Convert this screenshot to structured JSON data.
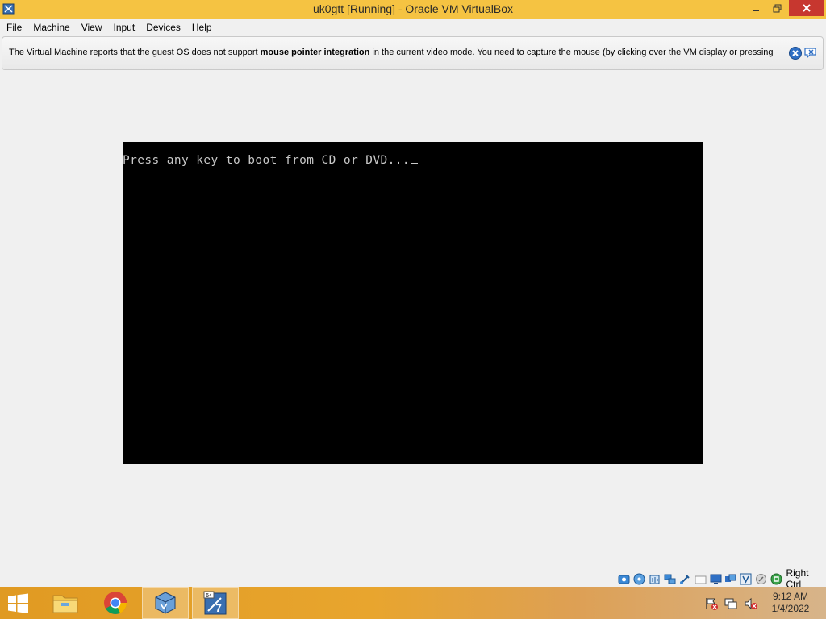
{
  "window": {
    "title": "uk0gtt [Running] - Oracle VM VirtualBox"
  },
  "menu": [
    "File",
    "Machine",
    "View",
    "Input",
    "Devices",
    "Help"
  ],
  "notice": {
    "text_before": "The Virtual Machine reports that the guest OS does not support ",
    "text_bold": "mouse pointer integration",
    "text_after": " in the current video mode. You need to capture the mouse (by clicking over the VM display or pressing"
  },
  "vm": {
    "console_text": "Press any key to boot from CD or DVD..."
  },
  "statusbar": {
    "icons": [
      "hard-disk-icon",
      "optical-disk-icon",
      "audio-icon",
      "network-icon",
      "usb-icon",
      "shared-folders-icon",
      "display-icon",
      "video-capture-icon",
      "cpu-virtualization-icon",
      "mouse-integration-icon",
      "host-key-icon"
    ],
    "host_key": "Right Ctrl"
  },
  "taskbar": {
    "apps": [
      "file-explorer-icon",
      "chrome-icon",
      "virtualbox-icon",
      "vm-windows7-icon"
    ],
    "active_app": "vm-windows7-icon",
    "tray_icons": [
      "action-center-icon",
      "network-icon",
      "volume-muted-icon"
    ],
    "time": "9:12 AM",
    "date": "1/4/2022"
  },
  "colors": {
    "title_bar": "#f5c342",
    "close_button": "#c7372f",
    "vm_background": "#000000",
    "console_text": "#c8c8c8"
  }
}
